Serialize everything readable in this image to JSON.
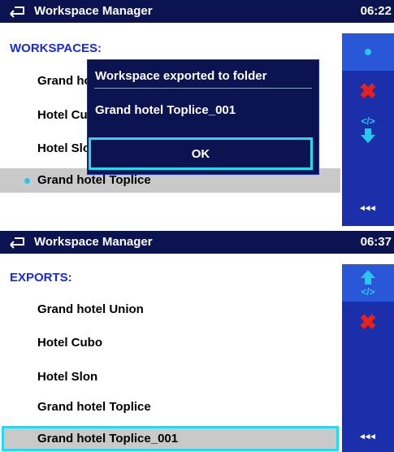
{
  "screen1": {
    "header": {
      "title": "Workspace Manager",
      "time": "06:22"
    },
    "section_label": "WORKSPACES:",
    "items": [
      {
        "label": "Grand hotel Union"
      },
      {
        "label": "Hotel Cubo"
      },
      {
        "label": "Hotel Slon"
      },
      {
        "label": "Grand hotel Toplice"
      }
    ],
    "dialog": {
      "title": "Workspace exported to folder",
      "folder": "Grand hotel Toplice_001",
      "ok_label": "OK"
    },
    "side_buttons": [
      "open-icon",
      "delete-icon",
      "export-icon",
      "",
      "back-icon"
    ]
  },
  "screen2": {
    "header": {
      "title": "Workspace Manager",
      "time": "06:37"
    },
    "section_label": "EXPORTS:",
    "items": [
      {
        "label": "Grand hotel Union"
      },
      {
        "label": "Hotel Cubo"
      },
      {
        "label": "Hotel Slon"
      },
      {
        "label": "Grand hotel Toplice"
      },
      {
        "label": "Grand hotel Toplice_001"
      }
    ],
    "side_buttons": [
      "import-icon",
      "delete-icon",
      "",
      "",
      "back-icon"
    ]
  },
  "colors": {
    "header_bg": "#0b1450",
    "accent_blue": "#1c2faa",
    "section_text": "#1a2cd6",
    "focus": "#26d8f0",
    "selection": "#c9c9c9",
    "delete_red": "#e8211c"
  }
}
